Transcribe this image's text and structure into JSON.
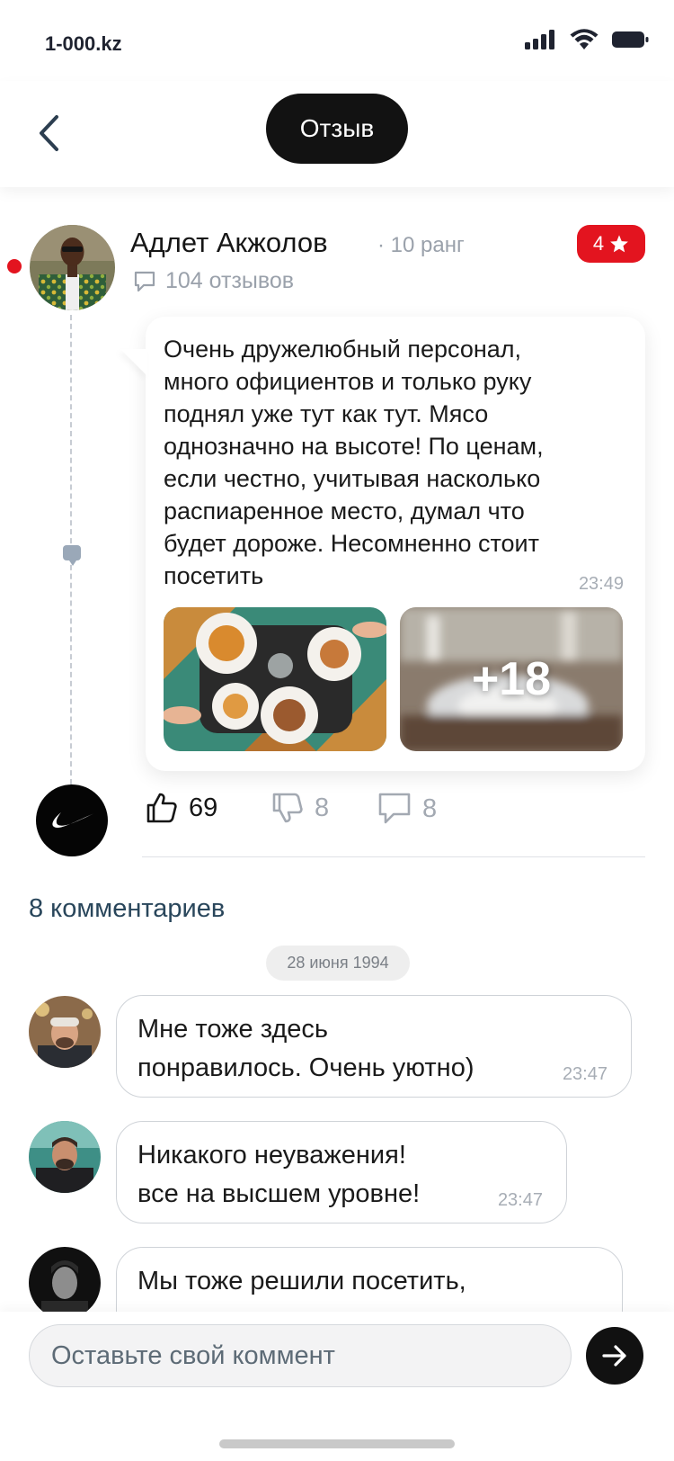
{
  "status_bar": {
    "domain": "1-000.kz"
  },
  "header": {
    "title": "Отзыв"
  },
  "review": {
    "author": "Адлет Акжолов",
    "rank": "· 10 ранг",
    "rating": "4",
    "reviews_count": "104 отзывов",
    "text_lines": [
      "Очень дружелюбный персонал,",
      "много официентов и только руку",
      "поднял уже тут как тут. Мясо",
      "однозначно на высоте! По ценам,",
      "если честно, учитывая насколько",
      "распиаренное место, думал что",
      "будет дороже. Несомненно стоит",
      "посетить"
    ],
    "time": "23:49",
    "extra_photos": "+18",
    "likes": "69",
    "dislikes": "8",
    "comments": "8"
  },
  "comments_section": {
    "title": "8 комментариев",
    "date": "28 июня 1994",
    "items": [
      {
        "lines": [
          "Мне тоже здесь",
          "понравилось. Очень уютно)"
        ],
        "time": "23:47"
      },
      {
        "lines": [
          "Никакого неуважения!",
          "все на высшем уровне!"
        ],
        "time": "23:47"
      },
      {
        "lines": [
          "Мы тоже решили посетить,"
        ],
        "time": ""
      }
    ]
  },
  "input": {
    "placeholder": "Оставьте свой коммент"
  },
  "colors": {
    "accent": "#e3141f",
    "dark": "#121212",
    "muted": "#9aa1ab",
    "section_title": "#29465b"
  },
  "icons": [
    "signal-icon",
    "wifi-icon",
    "battery-icon",
    "back-chevron-icon",
    "star-icon",
    "speech-bubble-icon",
    "thumbs-up-icon",
    "thumbs-down-icon",
    "comment-icon",
    "nike-logo",
    "arrow-right-icon"
  ]
}
